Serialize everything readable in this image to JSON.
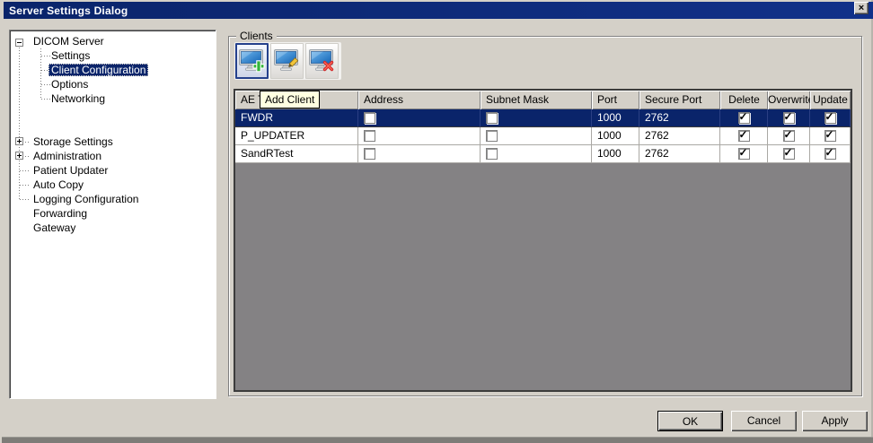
{
  "window": {
    "title": "Server Settings Dialog",
    "close_glyph": "×"
  },
  "tree": {
    "items": [
      {
        "label": "DICOM Server",
        "level": 0,
        "expander": "minus",
        "selected": false
      },
      {
        "label": "Settings",
        "level": 1,
        "expander": null,
        "selected": false
      },
      {
        "label": "Client Configuration",
        "level": 1,
        "expander": null,
        "selected": true
      },
      {
        "label": "Options",
        "level": 1,
        "expander": null,
        "selected": false
      },
      {
        "label": "Networking",
        "level": 1,
        "expander": null,
        "selected": false
      },
      {
        "label": "Storage Settings",
        "level": 0,
        "expander": "plus",
        "selected": false
      },
      {
        "label": "Administration",
        "level": 0,
        "expander": "plus",
        "selected": false
      },
      {
        "label": "Patient Updater",
        "level": 0,
        "expander": null,
        "selected": false
      },
      {
        "label": "Auto Copy",
        "level": 0,
        "expander": null,
        "selected": false
      },
      {
        "label": "Logging Configuration",
        "level": 0,
        "expander": null,
        "selected": false
      },
      {
        "label": "Forwarding",
        "level": 0,
        "expander": null,
        "selected": false
      },
      {
        "label": "Gateway",
        "level": 0,
        "expander": null,
        "selected": false
      }
    ]
  },
  "clients": {
    "group_label": "Clients",
    "toolbar": {
      "buttons": [
        {
          "name": "add-client",
          "icon": "monitor-plus-icon"
        },
        {
          "name": "edit-client",
          "icon": "monitor-pencil-icon"
        },
        {
          "name": "delete-client",
          "icon": "monitor-x-icon"
        }
      ],
      "tooltip": "Add Client"
    },
    "table": {
      "columns": [
        "AE Title",
        "Address",
        "Subnet Mask",
        "Port",
        "Secure Port",
        "Delete",
        "Overwrite",
        "Update"
      ],
      "rows": [
        {
          "ae_title": "FWDR",
          "address_checked": false,
          "subnet_checked": false,
          "port": "1000",
          "secure_port": "2762",
          "delete_checked": true,
          "overwrite_checked": true,
          "update_checked": true,
          "selected": true
        },
        {
          "ae_title": "P_UPDATER",
          "address_checked": false,
          "subnet_checked": false,
          "port": "1000",
          "secure_port": "2762",
          "delete_checked": true,
          "overwrite_checked": true,
          "update_checked": true,
          "selected": false
        },
        {
          "ae_title": "SandRTest",
          "address_checked": false,
          "subnet_checked": false,
          "port": "1000",
          "secure_port": "2762",
          "delete_checked": true,
          "overwrite_checked": true,
          "update_checked": true,
          "selected": false
        }
      ]
    }
  },
  "footer": {
    "ok_label": "OK",
    "cancel_label": "Cancel",
    "apply_label": "Apply"
  },
  "colors": {
    "titlebar": "#0a246a",
    "selection": "#0a246a",
    "dialog_bg": "#d4d0c8",
    "table_empty": "#848284",
    "tooltip_bg": "#ffffe1"
  }
}
